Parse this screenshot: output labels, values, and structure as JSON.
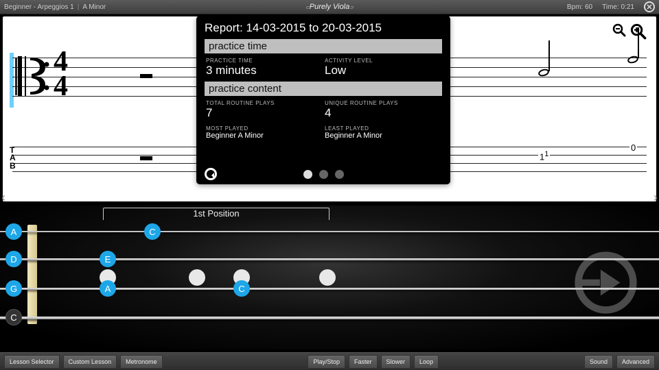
{
  "topbar": {
    "lesson_group": "Beginner - Arpeggios 1",
    "lesson_key": "A Minor",
    "brand": "Purely Viola",
    "bpm_label": "Bpm:",
    "bpm_value": "60",
    "time_label": "Time:",
    "time_value": "0:21"
  },
  "score": {
    "time_top": "4",
    "time_bot": "4",
    "tab_label_t": "T",
    "tab_label_a": "A",
    "tab_label_b": "B",
    "tab_n_right": "0",
    "tab_n_mid": "1",
    "tab_n_mid_sup": "1"
  },
  "report": {
    "title": "Report: 14-03-2015  to  20-03-2015",
    "section1": "practice time",
    "practice_time_label": "PRACTICE TIME",
    "practice_time_value": "3 minutes",
    "activity_label": "ACTIVITY LEVEL",
    "activity_value": "Low",
    "section2": "practice content",
    "total_plays_label": "TOTAL ROUTINE PLAYS",
    "total_plays_value": "7",
    "unique_plays_label": "UNIQUE ROUTINE PLAYS",
    "unique_plays_value": "4",
    "most_played_label": "MOST PLAYED",
    "most_played_value": "Beginner A Minor",
    "least_played_label": "LEAST PLAYED",
    "least_played_value": "Beginner A Minor"
  },
  "fretboard": {
    "position_label": "1st Position",
    "open": {
      "s1": "A",
      "s2": "D",
      "s3": "G",
      "s4": "C"
    },
    "notes": {
      "c_top": "C",
      "e_mid": "E",
      "a_low": "A",
      "c_low": "C"
    }
  },
  "toolbar": {
    "lesson_selector": "Lesson Selector",
    "custom_lesson": "Custom Lesson",
    "metronome": "Metronome",
    "play_stop": "Play/Stop",
    "faster": "Faster",
    "slower": "Slower",
    "loop": "Loop",
    "sound": "Sound",
    "advanced": "Advanced"
  }
}
